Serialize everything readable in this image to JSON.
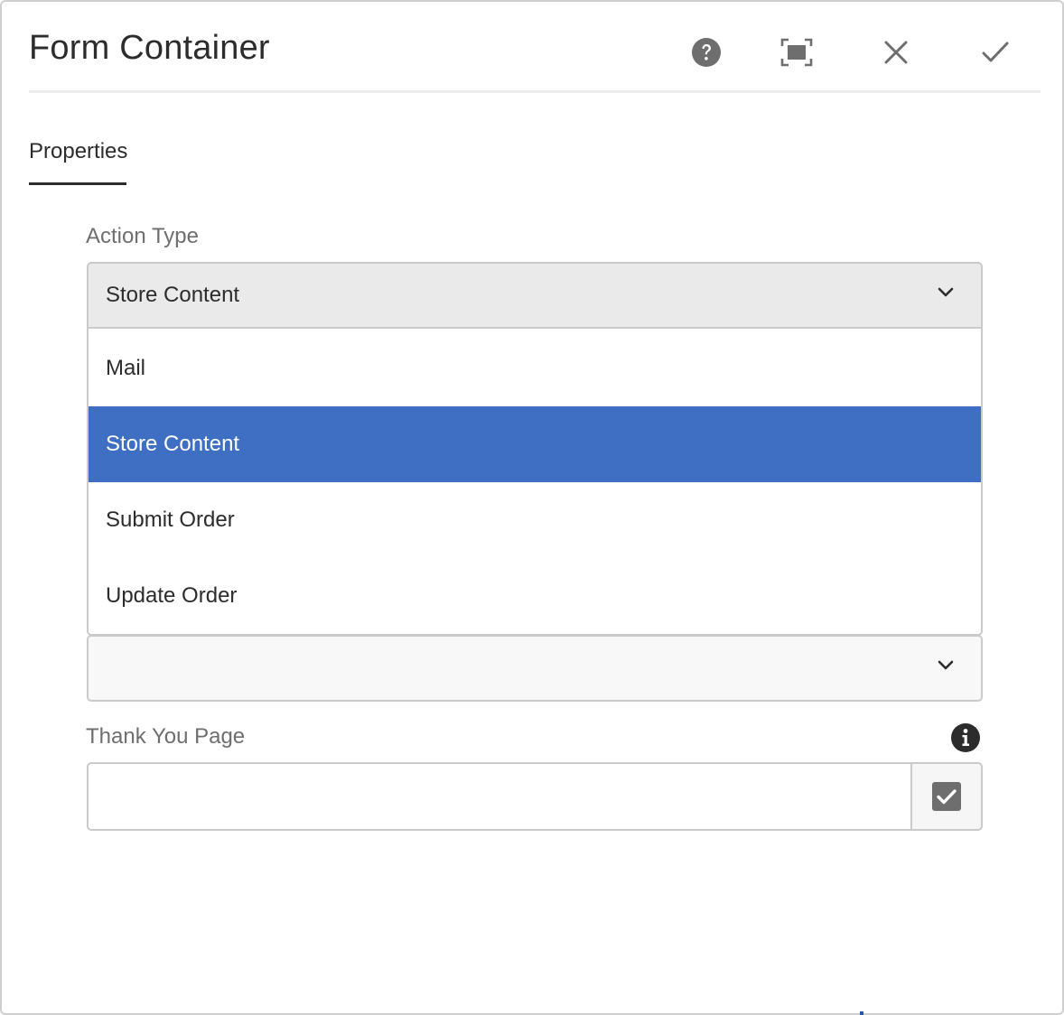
{
  "dialog": {
    "title": "Form Container"
  },
  "header": {
    "help_icon": "help-circle-icon",
    "fullscreen_icon": "fullscreen-icon",
    "close_icon": "close-icon",
    "done_icon": "checkmark-icon"
  },
  "tabs": [
    {
      "label": "Properties",
      "active": true
    }
  ],
  "action_type": {
    "label": "Action Type",
    "selected": "Store Content",
    "options": [
      "Mail",
      "Store Content",
      "Submit Order",
      "Update Order"
    ]
  },
  "second_select": {
    "selected": ""
  },
  "thank_you_page": {
    "label": "Thank You Page",
    "value": "",
    "info_icon": "info-icon",
    "picker_icon": "checkbox-check-icon"
  },
  "colors": {
    "accent": "#3f6fc2",
    "icon": "#6e6e6e",
    "text": "#2c2c2c"
  }
}
